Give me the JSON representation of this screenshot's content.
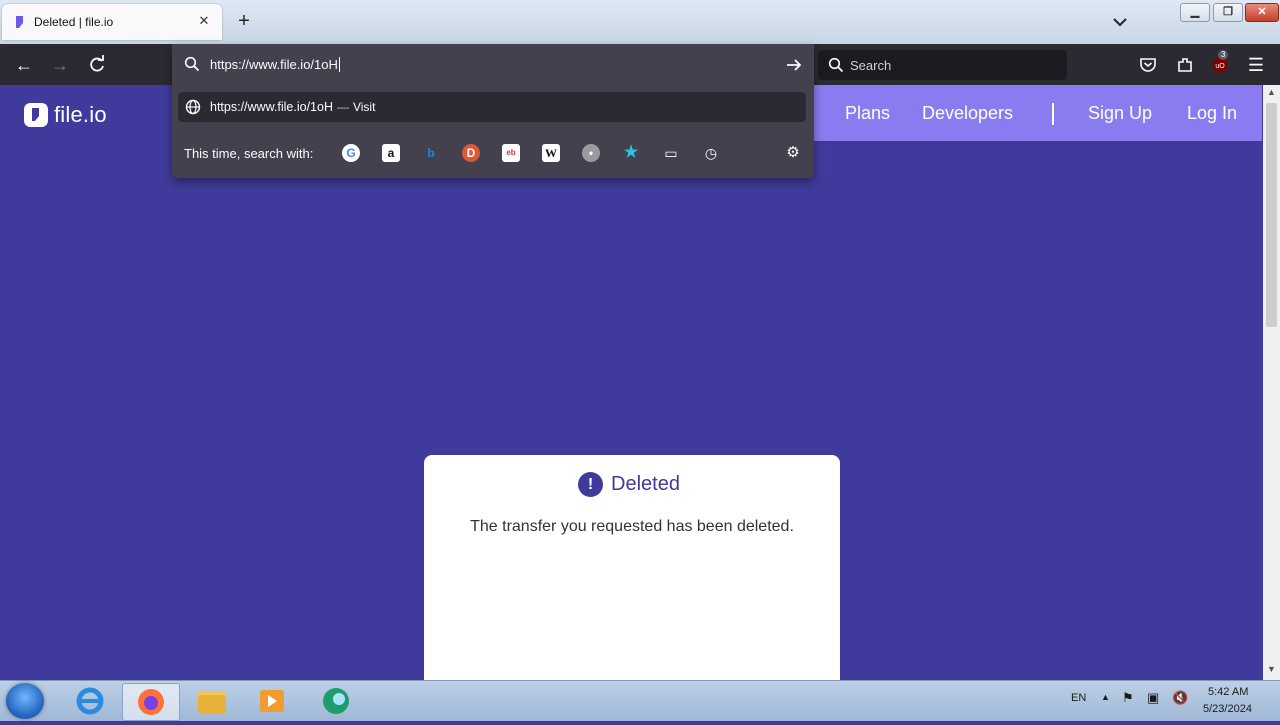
{
  "browser": {
    "tab": {
      "title": "Deleted | file.io"
    },
    "url": {
      "value": "https://www.file.io/1oH"
    },
    "suggestion": {
      "url": "https://www.file.io/1oH",
      "separator": "—",
      "action": "Visit"
    },
    "oneoff_label": "This time, search with:",
    "search_placeholder": "Search",
    "extension_badge": "3"
  },
  "site": {
    "logo_text": "file.io",
    "nav": {
      "plans": "Plans",
      "developers": "Developers",
      "signup": "Sign Up",
      "login": "Log In"
    },
    "colors": {
      "primary": "#403a9c",
      "header_accent": "#8a7cf0"
    }
  },
  "card": {
    "title": "Deleted",
    "message": "The transfer you requested has been deleted."
  },
  "taskbar": {
    "language": "EN",
    "time": "5:42 AM",
    "date": "5/23/2024"
  }
}
